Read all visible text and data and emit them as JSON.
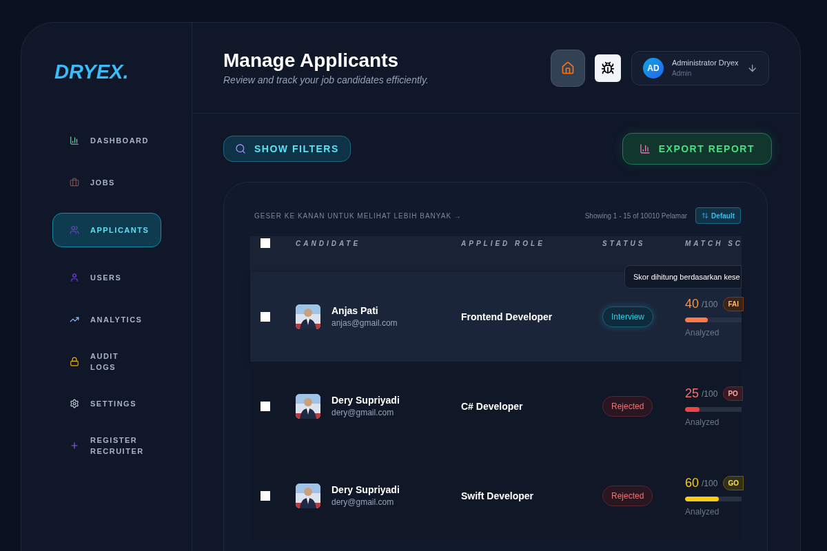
{
  "brand": "DRYEX.",
  "sidebar": {
    "items": [
      {
        "label": "DASHBOARD",
        "kind": "chart",
        "selected": false
      },
      {
        "label": "JOBS",
        "kind": "briefcase",
        "selected": false
      },
      {
        "label": "APPLICANTS",
        "kind": "users",
        "selected": true
      },
      {
        "label": "USERS",
        "kind": "user",
        "selected": false
      },
      {
        "label": "ANALYTICS",
        "kind": "trend",
        "selected": false
      },
      {
        "label": "AUDIT LOGS",
        "kind": "lock",
        "selected": false
      },
      {
        "label": "SETTINGS",
        "kind": "gear",
        "selected": false
      },
      {
        "label": "REGISTER RECRUITER",
        "kind": "plus",
        "selected": false
      }
    ]
  },
  "header": {
    "title": "Manage Applicants",
    "subtitle": "Review and track your job candidates efficiently.",
    "user": {
      "initials": "AD",
      "name": "Administrator Dryex",
      "role": "Admin"
    }
  },
  "toolbar": {
    "filters_button": "SHOW FILTERS",
    "export_button": "EXPORT REPORT"
  },
  "table": {
    "hint": "GESER KE KANAN UNTUK MELIHAT LEBIH BANYAK →",
    "count": "Showing 1 - 15 of 10010 Pelamar",
    "sort_button": "Default",
    "select_all_checked": false,
    "columns": [
      "CANDIDATE",
      "APPLIED ROLE",
      "STATUS",
      "MATCH SC"
    ],
    "tooltip": "Skor dihitung berdasarkan kese",
    "rows": [
      {
        "name": "Anjas Pati",
        "email": "anjas@gmail.com",
        "role": "Frontend Developer",
        "status": {
          "label": "Interview",
          "kind": "interview"
        },
        "score": "40",
        "max": "/100",
        "grade": {
          "label": "FAI",
          "kind": "fair"
        },
        "level": 0.4,
        "note": "Analyzed",
        "checked": false,
        "highlighted": true
      },
      {
        "name": "Dery Supriyadi",
        "email": "dery@gmail.com",
        "role": "C# Developer",
        "status": {
          "label": "Rejected",
          "kind": "rejected"
        },
        "score": "25",
        "max": "/100",
        "grade": {
          "label": "PO",
          "kind": "poor"
        },
        "level": 0.25,
        "note": "Analyzed",
        "checked": false,
        "highlighted": false
      },
      {
        "name": "Dery Supriyadi",
        "email": "dery@gmail.com",
        "role": "Swift Developer",
        "status": {
          "label": "Rejected",
          "kind": "rejected"
        },
        "score": "60",
        "max": "/100",
        "grade": {
          "label": "GO",
          "kind": "good"
        },
        "level": 0.6,
        "note": "Analyzed",
        "checked": false,
        "highlighted": false
      }
    ]
  }
}
